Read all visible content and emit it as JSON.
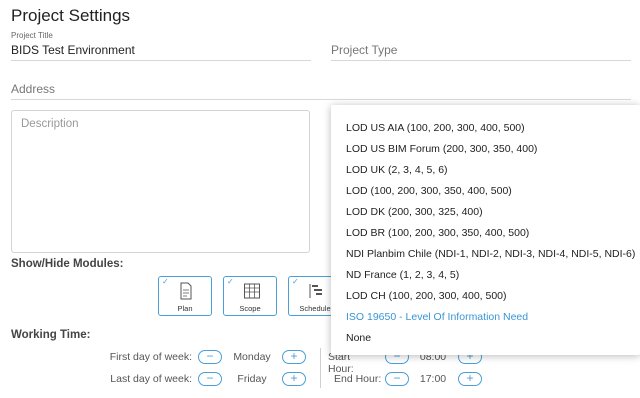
{
  "page_title": "Project Settings",
  "project_title": {
    "caption": "Project Title",
    "value": "BIDS Test Environment"
  },
  "project_type": {
    "placeholder": "Project Type"
  },
  "address": {
    "placeholder": "Address"
  },
  "description": {
    "placeholder": "Description"
  },
  "modules": {
    "label": "Show/Hide Modules:",
    "items": [
      {
        "label": "Plan",
        "checked": true,
        "icon": "document-icon"
      },
      {
        "label": "Scope",
        "checked": true,
        "icon": "table-icon"
      },
      {
        "label": "Schedule",
        "checked": true,
        "icon": "gantt-icon"
      }
    ]
  },
  "working_time": {
    "label": "Working Time:",
    "first_day": {
      "label": "First day of week:",
      "value": "Monday"
    },
    "last_day": {
      "label": "Last day of week:",
      "value": "Friday"
    },
    "start_hour": {
      "label": "Start Hour:",
      "value": "08:00"
    },
    "end_hour": {
      "label": "End Hour:",
      "value": "17:00"
    },
    "minus": "−",
    "plus": "+"
  },
  "dropdown": {
    "options": [
      "LOD US AIA (100, 200, 300, 400, 500)",
      "LOD US BIM Forum (200, 300, 350, 400)",
      "LOD UK (2, 3, 4, 5, 6)",
      "LOD (100, 200, 300, 350, 400, 500)",
      "LOD DK (200, 300, 325, 400)",
      "LOD BR (100, 200, 300, 350, 400, 500)",
      "NDI Planbim Chile (NDI-1, NDI-2, NDI-3, NDI-4, NDI-5, NDI-6)",
      "ND France (1, 2, 3, 4, 5)",
      "LOD CH (100, 200, 300, 400, 500)",
      "ISO 19650 - Level Of Information Need",
      "None"
    ],
    "highlighted": "ISO 19650 - Level Of Information Need"
  },
  "colors": {
    "accent": "#4a9fd8",
    "highlight_text": "#3a95d4"
  }
}
